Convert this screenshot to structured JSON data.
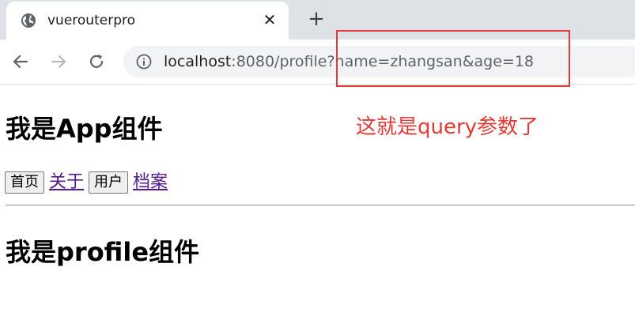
{
  "browser": {
    "tab_title": "vuerouterpro",
    "url_host": "localhost",
    "url_rest": ":8080/profile?name=zhangsan&age=18",
    "tab_close_glyph": "✕",
    "new_tab_glyph": "+"
  },
  "app": {
    "title": "我是App组件",
    "nav": [
      {
        "type": "button",
        "label": "首页"
      },
      {
        "type": "link",
        "label": "关于"
      },
      {
        "type": "button",
        "label": "用户"
      },
      {
        "type": "link",
        "label": "档案"
      }
    ],
    "profile_title": "我是profile组件"
  },
  "annotation": {
    "text": "这就是query参数了",
    "color": "#e53935"
  },
  "colors": {
    "tabstrip": "#dee1e6",
    "omnibox": "#f1f3f4",
    "link_visited": "#551a8b"
  }
}
